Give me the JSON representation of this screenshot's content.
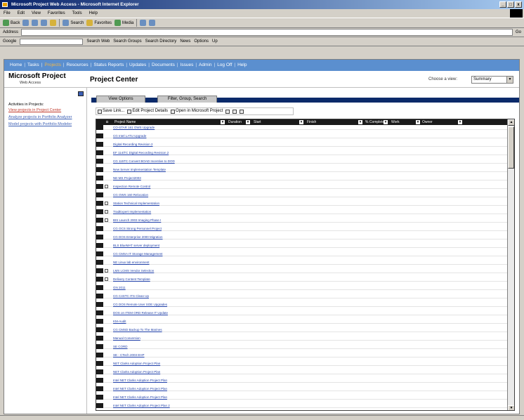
{
  "window": {
    "title": "Microsoft Project Web Access - Microsoft Internet Explorer",
    "controls": [
      "_",
      "□",
      "x"
    ]
  },
  "menubar": [
    "File",
    "Edit",
    "View",
    "Favorites",
    "Tools",
    "Help"
  ],
  "toolbar": {
    "items": [
      "Back",
      "Search",
      "Favorites",
      "Media"
    ]
  },
  "address": {
    "label": "Address",
    "go": "Go"
  },
  "linksbar": {
    "google": "Google",
    "items": [
      "Search Web",
      "Search Groups",
      "Search Directory",
      "News",
      "Options",
      "Up"
    ]
  },
  "topnav": {
    "items": [
      "Home",
      "Tasks",
      "Projects",
      "Resources",
      "Status Reports",
      "Updates",
      "Documents",
      "Issues",
      "Admin",
      "Log Off",
      "Help"
    ],
    "active": "Projects"
  },
  "header": {
    "logo": "Microsoft Project",
    "logo_sub": "Web Access",
    "page_title": "Project Center",
    "view_label": "Choose a view:",
    "view_value": "Summary"
  },
  "sidebar": {
    "actions_label": "Activities in Projects:",
    "links": [
      "View projects in Project Center",
      "Analyze projects in Portfolio Analyzer",
      "Model projects with Portfolio Modeler"
    ]
  },
  "tabs": [
    "View Options",
    "Filter, Group, Search"
  ],
  "actionbar": {
    "items": [
      "Save Link...",
      "Edit Project Details",
      "Open in Microsoft Project"
    ]
  },
  "grid": {
    "headers": [
      "Project Name",
      "Duration",
      "Start",
      "Finish",
      "% Complete",
      "Work",
      "Owner"
    ],
    "rows": [
      {
        "name": "CO-STAR 161 OWS Upgrade",
        "checked": false
      },
      {
        "name": "CG Intel LATU Upgrade",
        "checked": false
      },
      {
        "name": "Digital Recording Revision 2",
        "checked": false
      },
      {
        "name": "EF 114/TC Digital Recording Revision 2",
        "checked": false
      },
      {
        "name": "CG 115TC Convert BOAD Incentive to DOD",
        "checked": false
      },
      {
        "name": "New Server Implementation Template",
        "checked": false
      },
      {
        "name": "NE-MS Project2003",
        "checked": false
      },
      {
        "name": "Inspection Remote Control",
        "checked": true
      },
      {
        "name": "CG OWS 160 Relocation",
        "checked": false
      },
      {
        "name": "Station Technical Implementation",
        "checked": true
      },
      {
        "name": "TradExpert Implementation",
        "checked": true
      },
      {
        "name": "BIS Launch 2003 Imaging Phase I",
        "checked": true
      },
      {
        "name": "CG OCS Strong Personnel Project",
        "checked": false
      },
      {
        "name": "CG DOS Enterprise 2000 Migration",
        "checked": false
      },
      {
        "name": "BLS BlueMAT server deployment",
        "checked": false
      },
      {
        "name": "CG CMSA IT Storage Management",
        "checked": false
      },
      {
        "name": "NE Linux lab environment",
        "checked": false
      },
      {
        "name": "LMS LCMS Vendor Selection",
        "checked": true
      },
      {
        "name": "Delivery Content Template",
        "checked": true
      },
      {
        "name": "GN 2011",
        "checked": false
      },
      {
        "name": "CG C4STC ITS Clean Up",
        "checked": false
      },
      {
        "name": "CG DOS Remote User SOE Upgrades",
        "checked": false
      },
      {
        "name": "DOS on ITEM ORD Release IT Update",
        "checked": false
      },
      {
        "name": "KM-Audit",
        "checked": false
      },
      {
        "name": "CG CMSD Backup To The Marines",
        "checked": false
      },
      {
        "name": "Manual Conversion",
        "checked": false
      },
      {
        "name": "SE CORD",
        "checked": false
      },
      {
        "name": "SE - CTech 2003 EHP",
        "checked": false
      },
      {
        "name": "NET Clarks Adoption Project Plan",
        "checked": false
      },
      {
        "name": "NET Clarks Adoption Project Plan",
        "checked": false
      },
      {
        "name": "Intel NET Clarks Adoption Project Plan",
        "checked": false
      },
      {
        "name": "Intel NET Clarks Adoption Project Plan",
        "checked": false
      },
      {
        "name": "Intel NET Clarks Adoption Project Plan",
        "checked": false
      },
      {
        "name": "Intel NET Clarks Adoption Project Plan 2",
        "checked": false
      }
    ]
  }
}
